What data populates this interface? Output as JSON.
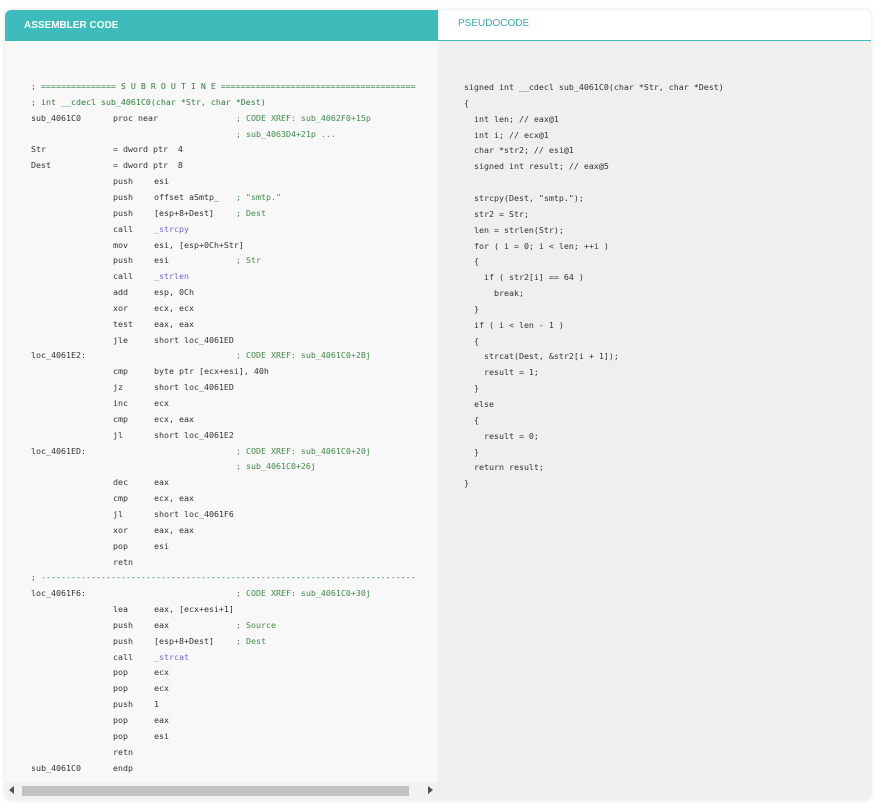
{
  "tabs": {
    "assembler": "ASSEMBLER CODE",
    "pseudocode": "PSEUDOCODE"
  },
  "colors": {
    "accent": "#3dbcbb",
    "comment": "#3f8b4a",
    "identifier": "#6b6bd4"
  },
  "asm": [
    {
      "lab": "; =============== S U B R O U T I N E =======================================",
      "mn": "",
      "op": "",
      "cm": ""
    },
    {
      "lab": "; int __cdecl sub_4061C0(char *Str, char *Dest)",
      "mn": "",
      "op": "",
      "cm": ""
    },
    {
      "lab": "sub_4061C0",
      "mn": "proc near",
      "op": "",
      "cm": "; CODE XREF: sub_4062F0+15p"
    },
    {
      "lab": "",
      "mn": "",
      "op": "",
      "cm": "; sub_4063D4+21p ..."
    },
    {
      "lab": "Str",
      "mn": "= dword ptr  4",
      "op": "",
      "cm": ""
    },
    {
      "lab": "Dest",
      "mn": "= dword ptr  8",
      "op": "",
      "cm": ""
    },
    {
      "lab": "",
      "mn": "push",
      "op": "esi",
      "cm": ""
    },
    {
      "lab": "",
      "mn": "push",
      "op": "offset aSmtp_",
      "cm": "; \"smtp.\""
    },
    {
      "lab": "",
      "mn": "push",
      "op": "[esp+8+Dest]",
      "cm": "; Dest"
    },
    {
      "lab": "",
      "mn": "call",
      "op": "_strcpy",
      "cm": ""
    },
    {
      "lab": "",
      "mn": "mov",
      "op": "esi, [esp+0Ch+Str]",
      "cm": ""
    },
    {
      "lab": "",
      "mn": "push",
      "op": "esi",
      "cm": "; Str"
    },
    {
      "lab": "",
      "mn": "call",
      "op": "_strlen",
      "cm": ""
    },
    {
      "lab": "",
      "mn": "add",
      "op": "esp, 0Ch",
      "cm": ""
    },
    {
      "lab": "",
      "mn": "xor",
      "op": "ecx, ecx",
      "cm": ""
    },
    {
      "lab": "",
      "mn": "test",
      "op": "eax, eax",
      "cm": ""
    },
    {
      "lab": "",
      "mn": "jle",
      "op": "short loc_4061ED",
      "cm": ""
    },
    {
      "lab": "loc_4061E2:",
      "mn": "",
      "op": "",
      "cm": "; CODE XREF: sub_4061C0+2Bj"
    },
    {
      "lab": "",
      "mn": "cmp",
      "op": "byte ptr [ecx+esi], 40h",
      "cm": ""
    },
    {
      "lab": "",
      "mn": "jz",
      "op": "short loc_4061ED",
      "cm": ""
    },
    {
      "lab": "",
      "mn": "inc",
      "op": "ecx",
      "cm": ""
    },
    {
      "lab": "",
      "mn": "cmp",
      "op": "ecx, eax",
      "cm": ""
    },
    {
      "lab": "",
      "mn": "jl",
      "op": "short loc_4061E2",
      "cm": ""
    },
    {
      "lab": "loc_4061ED:",
      "mn": "",
      "op": "",
      "cm": "; CODE XREF: sub_4061C0+20j"
    },
    {
      "lab": "",
      "mn": "",
      "op": "",
      "cm": "; sub_4061C0+26j"
    },
    {
      "lab": "",
      "mn": "dec",
      "op": "eax",
      "cm": ""
    },
    {
      "lab": "",
      "mn": "cmp",
      "op": "ecx, eax",
      "cm": ""
    },
    {
      "lab": "",
      "mn": "jl",
      "op": "short loc_4061F6",
      "cm": ""
    },
    {
      "lab": "",
      "mn": "xor",
      "op": "eax, eax",
      "cm": ""
    },
    {
      "lab": "",
      "mn": "pop",
      "op": "esi",
      "cm": ""
    },
    {
      "lab": "",
      "mn": "retn",
      "op": "",
      "cm": ""
    },
    {
      "lab": "; ---------------------------------------------------------------------------",
      "mn": "",
      "op": "",
      "cm": ""
    },
    {
      "lab": "loc_4061F6:",
      "mn": "",
      "op": "",
      "cm": "; CODE XREF: sub_4061C0+30j"
    },
    {
      "lab": "",
      "mn": "lea",
      "op": "eax, [ecx+esi+1]",
      "cm": ""
    },
    {
      "lab": "",
      "mn": "push",
      "op": "eax",
      "cm": "; Source"
    },
    {
      "lab": "",
      "mn": "push",
      "op": "[esp+8+Dest]",
      "cm": "; Dest"
    },
    {
      "lab": "",
      "mn": "call",
      "op": "_strcat",
      "cm": ""
    },
    {
      "lab": "",
      "mn": "pop",
      "op": "ecx",
      "cm": ""
    },
    {
      "lab": "",
      "mn": "pop",
      "op": "ecx",
      "cm": ""
    },
    {
      "lab": "",
      "mn": "push",
      "op": "1",
      "cm": ""
    },
    {
      "lab": "",
      "mn": "pop",
      "op": "eax",
      "cm": ""
    },
    {
      "lab": "",
      "mn": "pop",
      "op": "esi",
      "cm": ""
    },
    {
      "lab": "",
      "mn": "retn",
      "op": "",
      "cm": ""
    },
    {
      "lab": "sub_4061C0",
      "mn": "endp",
      "op": "",
      "cm": ""
    }
  ],
  "pseudo": [
    "signed int __cdecl sub_4061C0(char *Str, char *Dest)",
    "{",
    "  int len; // eax@1",
    "  int i; // ecx@1",
    "  char *str2; // esi@1",
    "  signed int result; // eax@5",
    "",
    "  strcpy(Dest, \"smtp.\");",
    "  str2 = Str;",
    "  len = strlen(Str);",
    "  for ( i = 0; i < len; ++i )",
    "  {",
    "    if ( str2[i] == 64 )",
    "      break;",
    "  }",
    "  if ( i < len - 1 )",
    "  {",
    "    strcat(Dest, &str2[i + 1]);",
    "    result = 1;",
    "  }",
    "  else",
    "  {",
    "    result = 0;",
    "  }",
    "  return result;",
    "}"
  ]
}
